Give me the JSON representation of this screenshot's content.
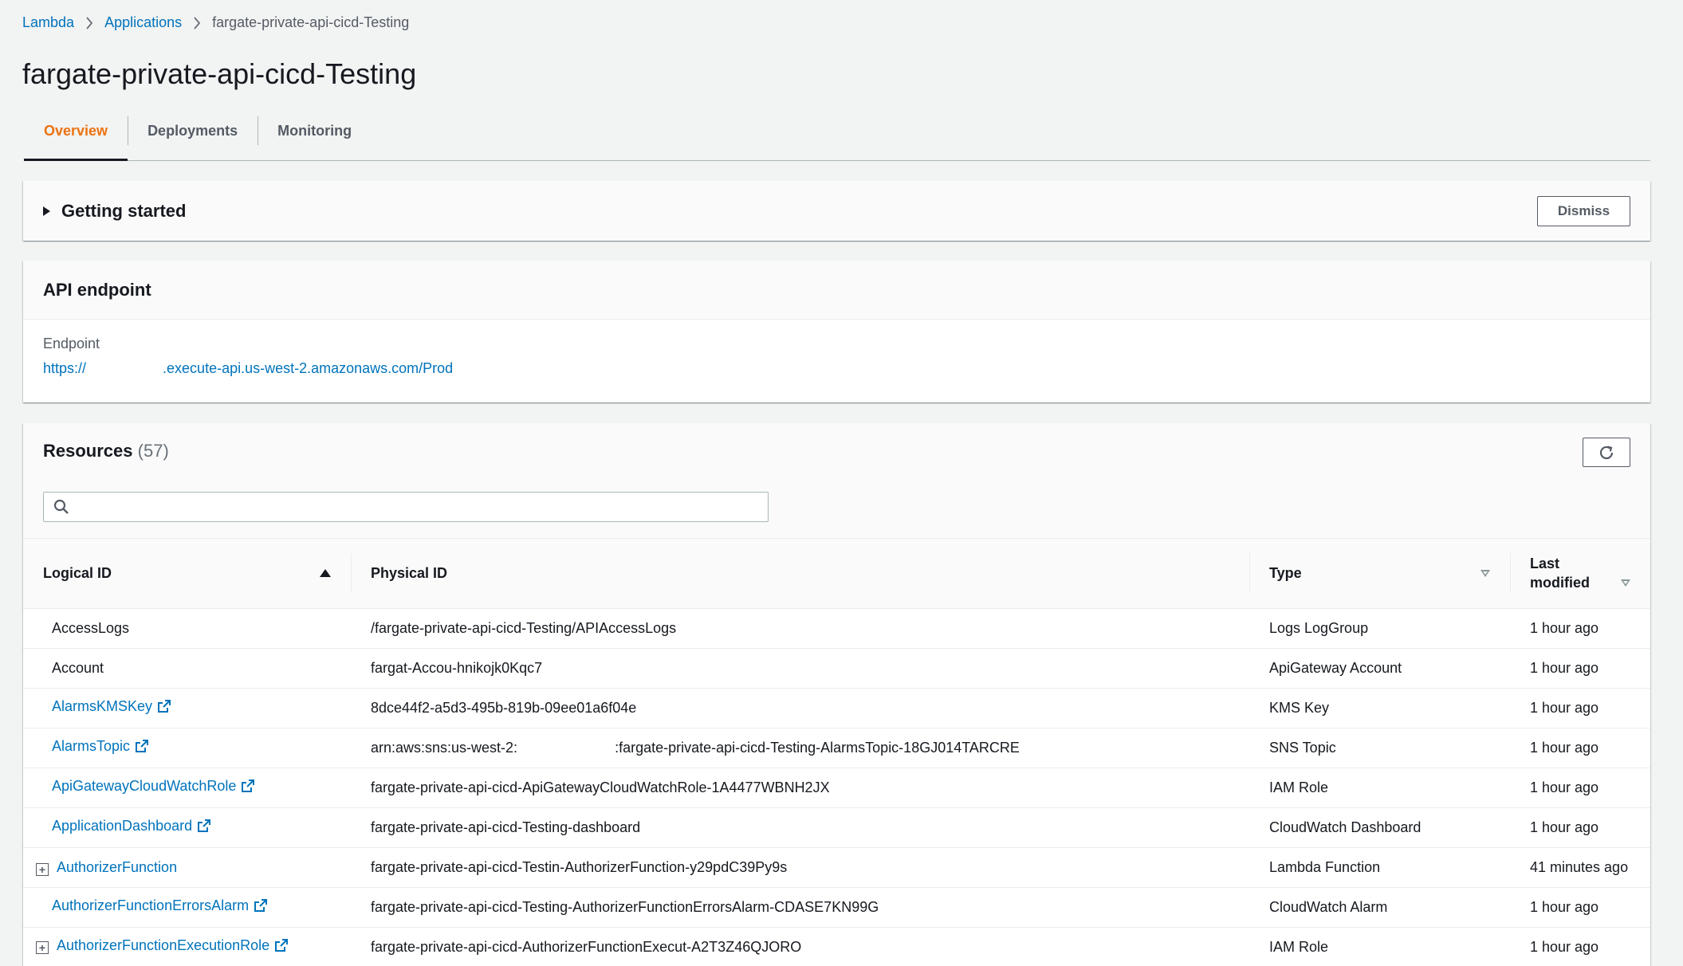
{
  "breadcrumb": [
    {
      "label": "Lambda"
    },
    {
      "label": "Applications"
    },
    {
      "label": "fargate-private-api-cicd-Testing"
    }
  ],
  "page": {
    "title": "fargate-private-api-cicd-Testing"
  },
  "tabs": [
    {
      "label": "Overview",
      "active": true
    },
    {
      "label": "Deployments",
      "active": false
    },
    {
      "label": "Monitoring",
      "active": false
    }
  ],
  "getting_started": {
    "title": "Getting started",
    "dismiss_label": "Dismiss"
  },
  "api_endpoint": {
    "title": "API endpoint",
    "label": "Endpoint",
    "value_prefix": "https://",
    "value_suffix": ".execute-api.us-west-2.amazonaws.com/Prod"
  },
  "resources": {
    "title": "Resources",
    "count": "(57)",
    "search_placeholder": "",
    "columns": {
      "logical_id": "Logical ID",
      "physical_id": "Physical ID",
      "type": "Type",
      "last_modified_line1": "Last",
      "last_modified_line2": "modified"
    },
    "rows": [
      {
        "logical": "AccessLogs",
        "physical": "/fargate-private-api-cicd-Testing/APIAccessLogs",
        "type": "Logs LogGroup",
        "modified": "1 hour ago"
      },
      {
        "logical": "Account",
        "physical": "fargat-Accou-hnikojk0Kqc7",
        "type": "ApiGateway Account",
        "modified": "1 hour ago"
      },
      {
        "logical": "AlarmsKMSKey",
        "physical": "8dce44f2-a5d3-495b-819b-09ee01a6f04e",
        "type": "KMS Key",
        "modified": "1 hour ago"
      },
      {
        "logical": "AlarmsTopic",
        "physical_prefix": "arn:aws:sns:us-west-2:",
        "physical_suffix": ":fargate-private-api-cicd-Testing-AlarmsTopic-18GJ014TARCRE",
        "type": "SNS Topic",
        "modified": "1 hour ago"
      },
      {
        "logical": "ApiGatewayCloudWatchRole",
        "physical": "fargate-private-api-cicd-ApiGatewayCloudWatchRole-1A4477WBNH2JX",
        "type": "IAM Role",
        "modified": "1 hour ago"
      },
      {
        "logical": "ApplicationDashboard",
        "physical": "fargate-private-api-cicd-Testing-dashboard",
        "type": "CloudWatch Dashboard",
        "modified": "1 hour ago"
      },
      {
        "logical": "AuthorizerFunction",
        "physical": "fargate-private-api-cicd-Testin-AuthorizerFunction-y29pdC39Py9s",
        "type": "Lambda Function",
        "modified": "41 minutes ago"
      },
      {
        "logical": "AuthorizerFunctionErrorsAlarm",
        "physical": "fargate-private-api-cicd-Testing-AuthorizerFunctionErrorsAlarm-CDASE7KN99G",
        "type": "CloudWatch Alarm",
        "modified": "1 hour ago"
      },
      {
        "logical": "AuthorizerFunctionExecutionRole",
        "physical": "fargate-private-api-cicd-AuthorizerFunctionExecut-A2T3Z46QJORO",
        "type": "IAM Role",
        "modified": "1 hour ago"
      }
    ]
  },
  "icons": {
    "breadcrumb_separator": "chevron-right-icon",
    "expand": "expand-plus-icon",
    "external": "external-link-icon",
    "search": "search-icon",
    "refresh": "refresh-icon"
  },
  "colors": {
    "accent": "#ec7211",
    "link": "#0073bb"
  }
}
